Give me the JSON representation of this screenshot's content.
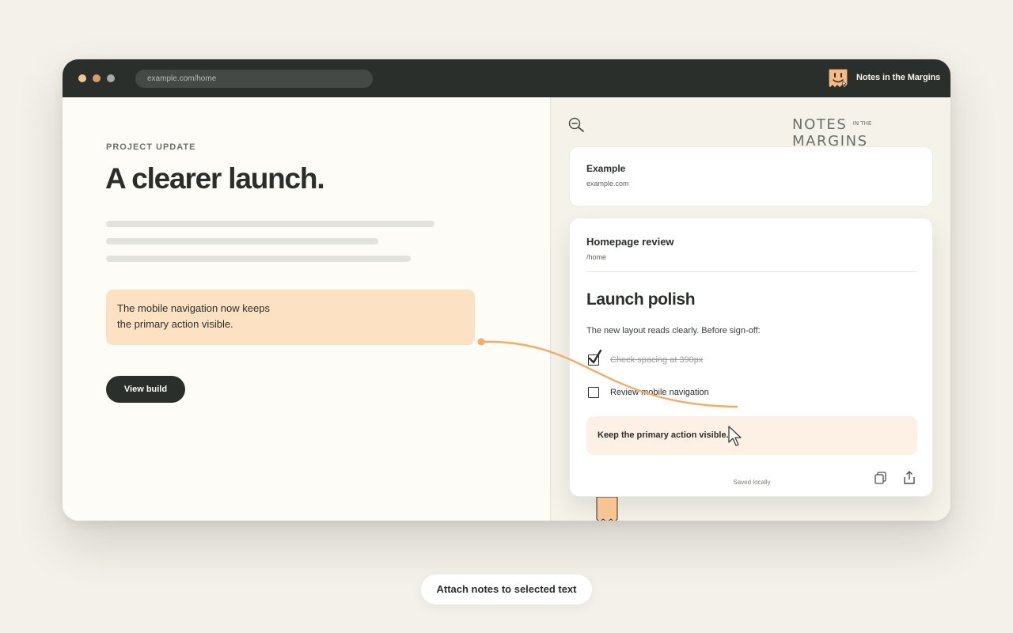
{
  "browser": {
    "url": "example.com/home",
    "extension_name": "Notes in the Margins",
    "traffic_lights": [
      "#f2c594",
      "#d99c62",
      "#a8aba6"
    ]
  },
  "page": {
    "eyebrow": "PROJECT UPDATE",
    "headline": "A clearer launch.",
    "highlight_lines": [
      "The mobile navigation now keeps",
      "the primary action visible."
    ],
    "button_label": "View build"
  },
  "sidebar": {
    "brand_script": {
      "notes": "NOTES",
      "in_the": "IN THE",
      "margins": "MARGINS"
    },
    "site": {
      "title": "Example",
      "url": "example.com"
    },
    "note": {
      "page_title": "Homepage review",
      "path": "/home",
      "heading": "Launch polish",
      "body": "The new layout reads clearly. Before sign-off:",
      "tasks": [
        {
          "label": "Check spacing at 390px",
          "checked": true
        },
        {
          "label": "Review mobile navigation",
          "checked": false
        }
      ],
      "callout": "Keep the primary action visible.",
      "status": "Saved locally"
    }
  },
  "caption": "Attach notes to selected text",
  "colors": {
    "accent": "#f2ac63",
    "highlight": "#fde1c3",
    "dark": "#2b2f2c"
  }
}
